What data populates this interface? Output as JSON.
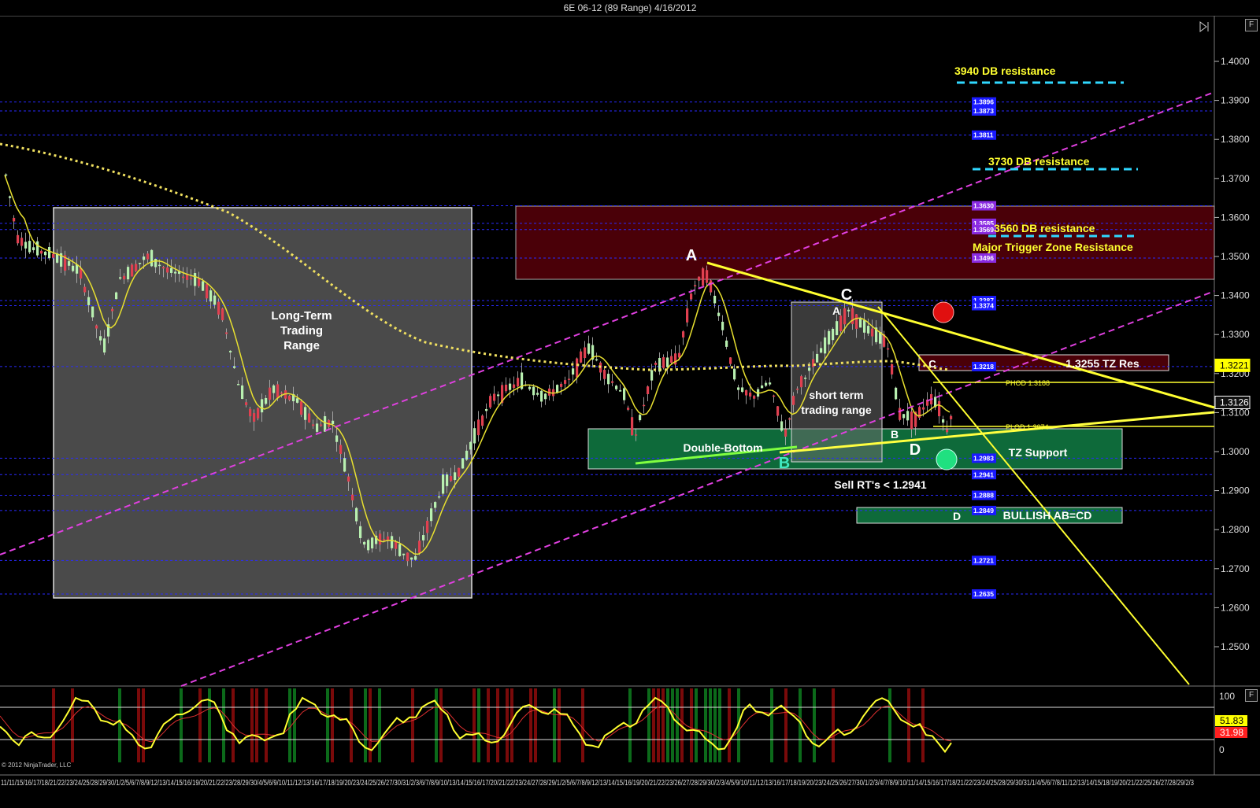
{
  "window": {
    "title": "6E 06-12 (89 Range)  4/16/2012",
    "panel_button": "F",
    "copyright": "© 2012 NinjaTrader, LLC"
  },
  "price_axis": {
    "ticks": [
      "1.4000",
      "1.3900",
      "1.3800",
      "1.3700",
      "1.3600",
      "1.3500",
      "1.3400",
      "1.3300",
      "1.3200",
      "1.3100",
      "1.3000",
      "1.2900",
      "1.2800",
      "1.2700",
      "1.2600",
      "1.2500"
    ],
    "current_markers": [
      {
        "value": "1.3221",
        "color": "#ffff00"
      },
      {
        "value": "1.3126",
        "color": "#ffffff"
      }
    ]
  },
  "level_tags": [
    {
      "text": "1.3896",
      "color": "#1a1aff"
    },
    {
      "text": "1.3873",
      "color": "#1a1aff"
    },
    {
      "text": "1.3811",
      "color": "#1a1aff"
    },
    {
      "text": "1.3630",
      "color": "#8a2be2"
    },
    {
      "text": "1.3585",
      "color": "#8a2be2"
    },
    {
      "text": "1.3569",
      "color": "#8a2be2"
    },
    {
      "text": "1.3496",
      "color": "#8a2be2"
    },
    {
      "text": "1.3387",
      "color": "#1a1aff"
    },
    {
      "text": "1.3374",
      "color": "#1a1aff"
    },
    {
      "text": "1.3218",
      "color": "#1a1aff"
    },
    {
      "text": "1.2983",
      "color": "#1a1aff"
    },
    {
      "text": "1.2941",
      "color": "#1a1aff"
    },
    {
      "text": "1.2888",
      "color": "#1a1aff"
    },
    {
      "text": "1.2849",
      "color": "#1a1aff"
    },
    {
      "text": "1.2721",
      "color": "#1a1aff"
    },
    {
      "text": "1.2635",
      "color": "#1a1aff"
    }
  ],
  "annotations": {
    "long_term_range": [
      "Long-Term",
      "Trading",
      "Range"
    ],
    "short_term_range": [
      "short term",
      "trading range"
    ],
    "double_bottom": "Double-Bottom",
    "tz_support": "TZ Support",
    "sell_note": "Sell RT's < 1.2941",
    "bullish": "BULLISH AB=CD",
    "tz_res": "1.3255 TZ Res",
    "phod": "PHOD 1.3188",
    "plod": "PLOD 1.3074",
    "res_3940": "3940 DB resistance",
    "res_3730": "3730 DB resistance",
    "res_3560": "3560 DB resistance",
    "major_trigger": "Major Trigger Zone Resistance",
    "pt_A_big": "A",
    "pt_C_big": "C",
    "pt_A_small": "A",
    "pt_B_big": "B",
    "pt_B_small": "B",
    "pt_D_big": "D",
    "pt_C_small": "C",
    "pt_D_small": "D"
  },
  "oscillator": {
    "ticks": [
      "100",
      "0"
    ],
    "values": [
      {
        "value": "51.83",
        "color": "#ffff00"
      },
      {
        "value": "31.98",
        "color": "#ff2020"
      }
    ]
  },
  "date_axis": "11/11/15/16/17/18/21/22/23/24/25/28/29/30/1/2/5/6/7/8/9/12/13/14/15/16/19/20/21/22/23/28/29/30/4/5/6/9/10/11/12/13/16/17/18/19/20/23/24/25/26/27/30/31/2/3/6/7/8/9/10/13/14/15/16/17/20/21/22/23/24/27/28/29/1/2/5/6/7/8/9/12/13/14/15/16/19/20/21/22/23/26/27/28/29/30/2/3/4/5/9/10/11/12/13/16/17/18/19/20/23/24/25/26/27/30/1/2/3/4/7/8/9/10/11/14/15/16/17/18/21/22/23/24/25/28/29/30/31/1/4/5/6/7/8/11/12/13/14/15/18/19/20/21/22/25/26/27/28/29/2/3"
}
